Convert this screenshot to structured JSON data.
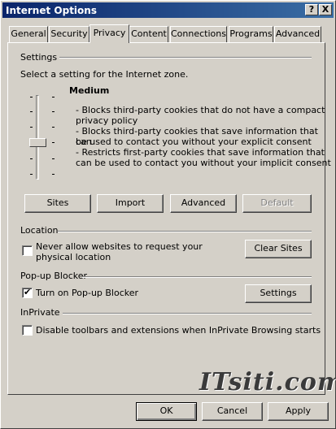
{
  "window": {
    "title": "Internet Options",
    "help_label": "?",
    "close_label": "X"
  },
  "tabs": [
    {
      "label": "General"
    },
    {
      "label": "Security"
    },
    {
      "label": "Privacy"
    },
    {
      "label": "Content"
    },
    {
      "label": "Connections"
    },
    {
      "label": "Programs"
    },
    {
      "label": "Advanced"
    }
  ],
  "active_tab": "Privacy",
  "settings": {
    "heading": "Settings",
    "prompt": "Select a setting for the Internet zone.",
    "level": "Medium",
    "descriptions": [
      "- Blocks third-party cookies that do not have a compact",
      "privacy policy",
      "- Blocks third-party cookies that save information that can",
      "be used to contact you without your explicit consent",
      "- Restricts first-party cookies that save information that",
      "can be used to contact you without your implicit consent"
    ],
    "buttons": {
      "sites": "Sites",
      "import": "Import",
      "advanced": "Advanced",
      "default": "Default"
    }
  },
  "location": {
    "heading": "Location",
    "checkbox_label_line1": "Never allow websites to request your",
    "checkbox_label_line2": "physical location",
    "checked": false,
    "clear_sites": "Clear Sites"
  },
  "popup": {
    "heading": "Pop-up Blocker",
    "checkbox_label": "Turn on Pop-up Blocker",
    "checked": true,
    "settings_button": "Settings"
  },
  "inprivate": {
    "heading": "InPrivate",
    "checkbox_label": "Disable toolbars and extensions when InPrivate Browsing starts",
    "checked": false
  },
  "watermark": "ITsiti.com",
  "footer": {
    "ok": "OK",
    "cancel": "Cancel",
    "apply": "Apply"
  }
}
